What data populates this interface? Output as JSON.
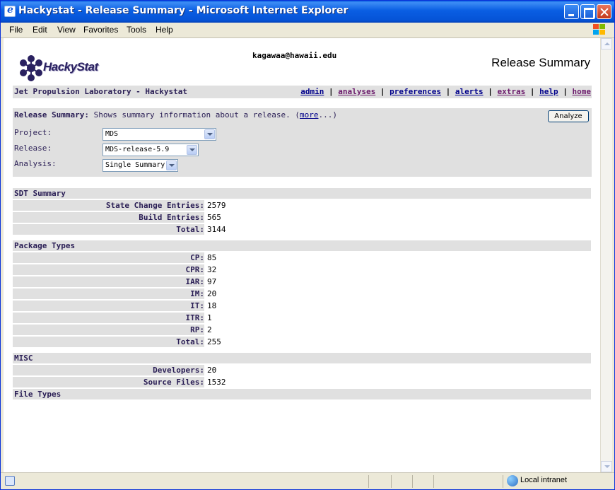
{
  "window": {
    "title": "Hackystat - Release Summary - Microsoft Internet Explorer"
  },
  "menubar": {
    "items": [
      "File",
      "Edit",
      "View",
      "Favorites",
      "Tools",
      "Help"
    ]
  },
  "header": {
    "logo_text": "HackyStat",
    "user_email": "kagawaa@hawaii.edu",
    "page_title": "Release Summary"
  },
  "navbar": {
    "org_name": "Jet Propulsion Laboratory - Hackystat",
    "links": [
      "admin",
      "analyses",
      "preferences",
      "alerts",
      "extras",
      "help",
      "home"
    ],
    "separator": "|"
  },
  "form": {
    "title": "Release Summary:",
    "description": " Shows summary information about a release. (",
    "more_link": "more",
    "more_suffix": "...)",
    "analyze_button": "Analyze",
    "project_label": "Project:",
    "project_value": "MDS",
    "release_label": "Release:",
    "release_value": "MDS-release-5.9",
    "analysis_label": "Analysis:",
    "analysis_value": "Single Summary"
  },
  "sections": {
    "sdt": {
      "title": "SDT Summary",
      "rows": [
        {
          "label": "State Change Entries:",
          "value": "2579"
        },
        {
          "label": "Build Entries:",
          "value": "565"
        },
        {
          "label": "Total:",
          "value": "3144"
        }
      ]
    },
    "package_types": {
      "title": "Package Types",
      "rows": [
        {
          "label": "CP:",
          "value": "85"
        },
        {
          "label": "CPR:",
          "value": "32"
        },
        {
          "label": "IAR:",
          "value": "97"
        },
        {
          "label": "IM:",
          "value": "20"
        },
        {
          "label": "IT:",
          "value": "18"
        },
        {
          "label": "ITR:",
          "value": "1"
        },
        {
          "label": "RP:",
          "value": "2"
        },
        {
          "label": "Total:",
          "value": "255"
        }
      ]
    },
    "misc": {
      "title": "MISC",
      "rows": [
        {
          "label": "Developers:",
          "value": "20"
        },
        {
          "label": "Source Files:",
          "value": "1532"
        }
      ]
    },
    "file_types": {
      "title": "File Types"
    }
  },
  "statusbar": {
    "zone": "Local intranet"
  }
}
